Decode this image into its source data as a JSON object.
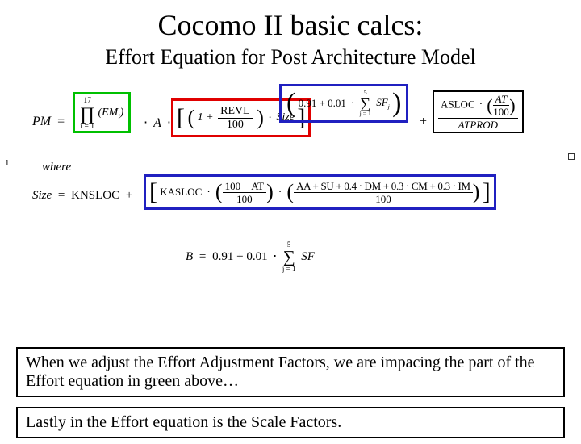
{
  "title": "Cocomo II basic calcs:",
  "subtitle": "Effort Equation for Post Architecture Model",
  "eq": {
    "pm": "PM",
    "eq": "=",
    "prod_upper": "17",
    "prod_lower": "i = 1",
    "prod_sym": "∏",
    "em": "(EM",
    "em_sub": "i",
    "em_close": ")",
    "times": "⋅",
    "a": "A",
    "one_plus": "1 +",
    "revl": "REVL",
    "hundred": "100",
    "size": "Size",
    "exp_const": "0.91 + 0.01",
    "sum_upper": "5",
    "sum_lower": "j = 1",
    "sum_sym": "∑",
    "sf": "SF",
    "sf_sub": "j",
    "plus": "+",
    "asloc": "ASLOC",
    "at": "AT",
    "atprod": "ATPROD"
  },
  "where_label": "where",
  "size_eq": {
    "lhs": "Size",
    "eq": "=",
    "knsloc": "KNSLOC",
    "plus": "+",
    "kasloc": "KASLOC",
    "times": "⋅",
    "frac1_num": "100 − AT",
    "frac1_den": "100",
    "frac2_num": "AA + SU + 0.4 ⋅ DM + 0.3 ⋅ CM + 0.3 ⋅ IM",
    "frac2_den": "100"
  },
  "b_eq": {
    "lhs": "B",
    "eq": "=",
    "const": "0.91 + 0.01",
    "times": "⋅",
    "sum_upper": "5",
    "sum_lower": "j = 1",
    "sum_sym": "∑",
    "sf": "SF"
  },
  "edge_left": "1",
  "callout1": "When we adjust the Effort Adjustment Factors, we are impacing the part of the Effort equation in green above…",
  "callout2": "Lastly in the Effort equation is the Scale Factors."
}
